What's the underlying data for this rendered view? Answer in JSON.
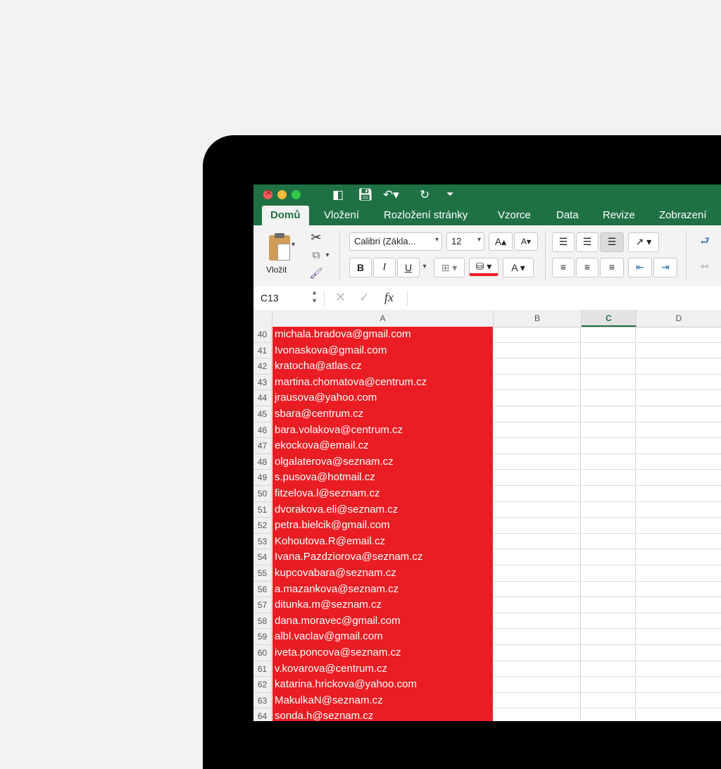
{
  "ribbon_tabs": [
    "Domů",
    "Vložení",
    "Rozložení stránky",
    "Vzorce",
    "Data",
    "Revize",
    "Zobrazení"
  ],
  "clipboard": {
    "paste_label": "Vložit"
  },
  "font": {
    "name": "Calibri (Zákla...",
    "size": "12"
  },
  "format_buttons": {
    "bold": "B",
    "italic": "I",
    "underline": "U"
  },
  "formula_bar": {
    "cell_ref": "C13",
    "fx_label": "fx"
  },
  "columns": [
    "A",
    "B",
    "C",
    "D"
  ],
  "selected_column": "C",
  "rows": [
    {
      "n": "40",
      "a": "michala.bradova@gmail.com"
    },
    {
      "n": "41",
      "a": "Ivonaskova@gmail.com"
    },
    {
      "n": "42",
      "a": "kratocha@atlas.cz"
    },
    {
      "n": "43",
      "a": "martina.chomatova@centrum.cz"
    },
    {
      "n": "44",
      "a": "jrausova@yahoo.com"
    },
    {
      "n": "45",
      "a": "sbara@centrum.cz"
    },
    {
      "n": "46",
      "a": "bara.volakova@centrum.cz"
    },
    {
      "n": "47",
      "a": "ekockova@email.cz"
    },
    {
      "n": "48",
      "a": "olgalaterova@seznam.cz"
    },
    {
      "n": "49",
      "a": "s.pusova@hotmail.cz"
    },
    {
      "n": "50",
      "a": "fitzelova.l@seznam.cz"
    },
    {
      "n": "51",
      "a": "dvorakova.eli@seznam.cz"
    },
    {
      "n": "52",
      "a": "petra.bielcik@gmail.com"
    },
    {
      "n": "53",
      "a": "Kohoutova.R@email.cz"
    },
    {
      "n": "54",
      "a": "Ivana.Pazdziorova@seznam.cz"
    },
    {
      "n": "55",
      "a": "kupcovabara@seznam.cz"
    },
    {
      "n": "56",
      "a": "a.mazankova@seznam.cz"
    },
    {
      "n": "57",
      "a": "ditunka.m@seznam.cz"
    },
    {
      "n": "58",
      "a": "dana.moravec@gmail.com"
    },
    {
      "n": "59",
      "a": "albl.vaclav@gmail.com"
    },
    {
      "n": "60",
      "a": "iveta.poncova@seznam.cz"
    },
    {
      "n": "61",
      "a": "v.kovarova@centrum.cz"
    },
    {
      "n": "62",
      "a": "katarina.hrickova@yahoo.com"
    },
    {
      "n": "63",
      "a": "MakulkaN@seznam.cz"
    },
    {
      "n": "64",
      "a": "sonda.h@seznam.cz"
    }
  ],
  "colors": {
    "titlebar": "#1f7144",
    "highlight": "#e91d23"
  }
}
